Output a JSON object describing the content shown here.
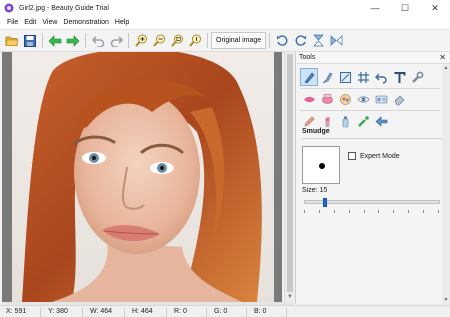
{
  "window": {
    "title": "Girl2.jpg - Beauty Guide Trial",
    "minimize_glyph": "—",
    "maximize_glyph": "☐",
    "close_glyph": "✕"
  },
  "menu": [
    "File",
    "Edit",
    "View",
    "Demonstration",
    "Help"
  ],
  "toolbar": {
    "original_image_label": "Original image",
    "icons": [
      "open-folder-icon",
      "save-icon",
      "back-arrow-icon",
      "forward-arrow-icon",
      "undo-icon",
      "redo-icon",
      "zoom-in-icon",
      "zoom-out-icon",
      "zoom-fit-icon",
      "zoom-actual-icon",
      "rotate-left-icon",
      "rotate-right-icon",
      "flip-vertical-icon",
      "flip-horizontal-icon"
    ]
  },
  "tools": {
    "header": "Tools",
    "close_glyph": "✕",
    "section_title": "Smudge",
    "expert_mode_label": "Expert Mode",
    "expert_mode_checked": false,
    "size_label": "Size: 15",
    "size_value": 15,
    "size_min": 1,
    "size_max": 100,
    "row1_icons": [
      "smudge-brush-icon",
      "brush-icon",
      "crop-icon",
      "grid-icon",
      "undo-curve-icon",
      "text-icon",
      "wrench-icon"
    ],
    "row2_icons": [
      "lips-icon",
      "blush-icon",
      "face-paint-icon",
      "eye-icon",
      "eye-shadow-icon",
      "eraser-icon"
    ],
    "row3_icons": [
      "pencil-icon",
      "lipstick-icon",
      "bottle-icon",
      "spray-icon",
      "back-icon"
    ]
  },
  "status": {
    "x": "X: 591",
    "y": "Y: 380",
    "w": "W: 464",
    "h": "H: 464",
    "r": "R: 0",
    "g": "G: 0",
    "b": "B: 0"
  },
  "colors": {
    "accent": "#1e6fd9",
    "canvas_bg": "#7a7a7a"
  }
}
